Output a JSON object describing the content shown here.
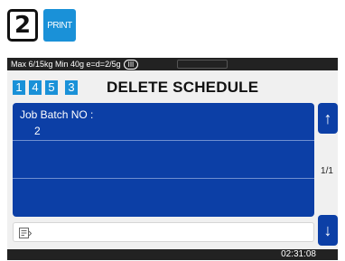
{
  "header": {
    "step_number": "2",
    "print_key_label": "PRINT"
  },
  "status_bar": {
    "scale_info": "Max 6/15kg Min 40g e=d=2/5g",
    "accuracy_class": "III"
  },
  "title_row": {
    "number_buttons": [
      "1",
      "4",
      "5",
      "3"
    ],
    "title": "DELETE SCHEDULE"
  },
  "list": {
    "rows": [
      {
        "label": "Job Batch NO :",
        "value": "2"
      },
      {
        "label": "",
        "value": ""
      },
      {
        "label": "",
        "value": ""
      }
    ]
  },
  "scroll": {
    "up_glyph": "↑",
    "down_glyph": "↓",
    "page_indicator": "1/1"
  },
  "input": {
    "icon": "note-edit-icon"
  },
  "footer": {
    "time": "02:31:08"
  },
  "colors": {
    "accent_blue": "#1a91d8",
    "panel_blue": "#0c3fa6",
    "bar_dark": "#222222"
  }
}
